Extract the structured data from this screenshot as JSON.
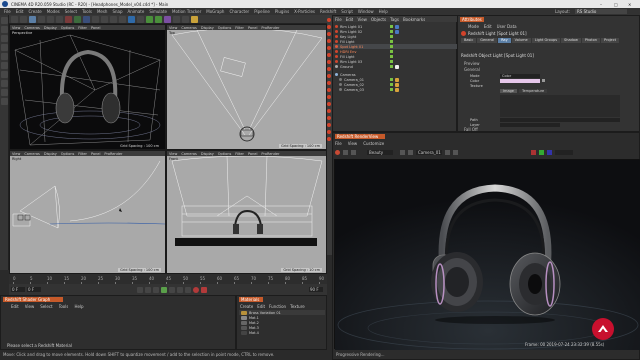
{
  "window": {
    "title": "CINEMA 4D R20.059 Studio (RC - R20) - [Headphones_Model_v04.c4d *] - Main"
  },
  "menu": [
    "File",
    "Edit",
    "Create",
    "Modes",
    "Select",
    "Tools",
    "Mesh",
    "Snap",
    "Animate",
    "Simulate",
    "Motion Tracker",
    "MoGraph",
    "Character",
    "Pipeline",
    "Plugins",
    "X-Particles",
    "Redshift",
    "Script",
    "Window",
    "Help"
  ],
  "layout_label": "Layout:",
  "layout_value": "RS Studio",
  "viewports": {
    "tl": {
      "name": "Perspective",
      "grid": "Grid Spacing : 100 cm"
    },
    "tr": {
      "name": "Top",
      "grid": "Grid Spacing : 100 cm"
    },
    "bl": {
      "name": "Right",
      "grid": "Grid Spacing : 100 cm"
    },
    "br": {
      "name": "Front",
      "grid": "Grid Spacing : 10 cm"
    },
    "menu": [
      "View",
      "Cameras",
      "Display",
      "Options",
      "Filter",
      "Panel",
      "ProRender"
    ]
  },
  "objects": {
    "tabs": [
      "File",
      "Edit",
      "View",
      "Objects",
      "Tags",
      "Bookmarks"
    ],
    "items": [
      "Rim Light 01",
      "Rim Light 02",
      "Key Light",
      "Fill Light",
      "Spot Light 01",
      "HDRI Env",
      "Fill Light",
      "Rim Light 03",
      "Ground",
      "Cameras",
      "Camera_01",
      "Camera_02",
      "Camera_03"
    ]
  },
  "attributes": {
    "title": "Attributes",
    "modes": [
      "Mode",
      "Edit",
      "User Data"
    ],
    "object_name": "Redshift Light [Spot Light 01]",
    "tabs": [
      "Basic",
      "General",
      "Ray",
      "Volume",
      "Light Groups",
      "Shadow",
      "Photon",
      "Project"
    ],
    "section": "Redshift Object Light [Spot Light 01]",
    "preview": "Preview",
    "general": "General",
    "fields": [
      {
        "label": "Mode",
        "value": "Color"
      },
      {
        "label": "Color",
        "value": ""
      },
      {
        "label": "Texture",
        "value": "Image"
      },
      {
        "label": "Path",
        "value": ""
      },
      {
        "label": "Layer",
        "value": ""
      }
    ],
    "image_btn": "Image",
    "temp_btn": "Temperature",
    "fall_off": "Fall Off"
  },
  "render": {
    "title": "Redshift RenderView",
    "menu": [
      "File",
      "View",
      "Customize"
    ],
    "camera": "Camera_01",
    "beauty": "Beauty",
    "status": "Frame: 00   2019-07-24  23:32:39  (8.55s)",
    "progressive": "Progressive Rendering..."
  },
  "timeline": {
    "ticks": [
      "0",
      "5",
      "10",
      "15",
      "20",
      "25",
      "30",
      "35",
      "40",
      "45",
      "50",
      "55",
      "60",
      "65",
      "70",
      "75",
      "80",
      "85",
      "90"
    ],
    "start": "0 F",
    "end": "90 F",
    "current": "0 F"
  },
  "material_mgr": {
    "title": "Redshift Shader Graph",
    "menu": [
      "Edit",
      "View",
      "Select",
      "Tools",
      "Help"
    ],
    "hint": "Please select a Redshift Material"
  },
  "materials": {
    "title": "Materials",
    "menu": [
      "Create",
      "Edit",
      "Function",
      "Texture"
    ],
    "items": [
      "Brass Variation 01",
      "Mat.1",
      "Mat.2",
      "Mat.3",
      "Mat.4"
    ]
  },
  "statusbar": "Move: Click and drag to move elements. Hold down SHIFT to quantize movement / add to the selection in point mode, CTRL to remove.",
  "colors": {
    "accent": "#5b7fa6",
    "logo": "#c8102e",
    "selected_light": "#e0513c"
  }
}
